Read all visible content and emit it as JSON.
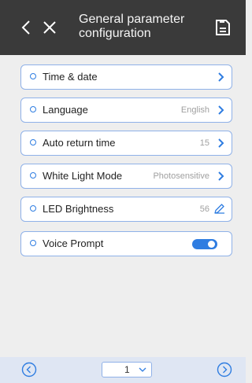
{
  "header": {
    "title_line1": "General parameter",
    "title_line2": "configuration",
    "icons": [
      "back-icon",
      "close-icon",
      "save-icon"
    ]
  },
  "settings": [
    {
      "label": "Time & date",
      "value": "",
      "control": "chevron"
    },
    {
      "label": "Language",
      "value": "English",
      "control": "chevron"
    },
    {
      "label": "Auto return time",
      "value": "15",
      "control": "chevron"
    },
    {
      "label": "White Light Mode",
      "value": "Photosensitive",
      "control": "chevron"
    },
    {
      "label": "LED Brightness",
      "value": "56",
      "control": "pencil"
    },
    {
      "label": "Voice Prompt",
      "value": "",
      "control": "toggle",
      "toggle_on": true
    }
  ],
  "pagination": {
    "current_page": "1"
  },
  "colors": {
    "header_bg": "#3a3a3a",
    "accent": "#2f7de1",
    "row_border": "#8fb1e8",
    "footer_bg": "#dfe6f3",
    "page_bg": "#eeeeee"
  }
}
